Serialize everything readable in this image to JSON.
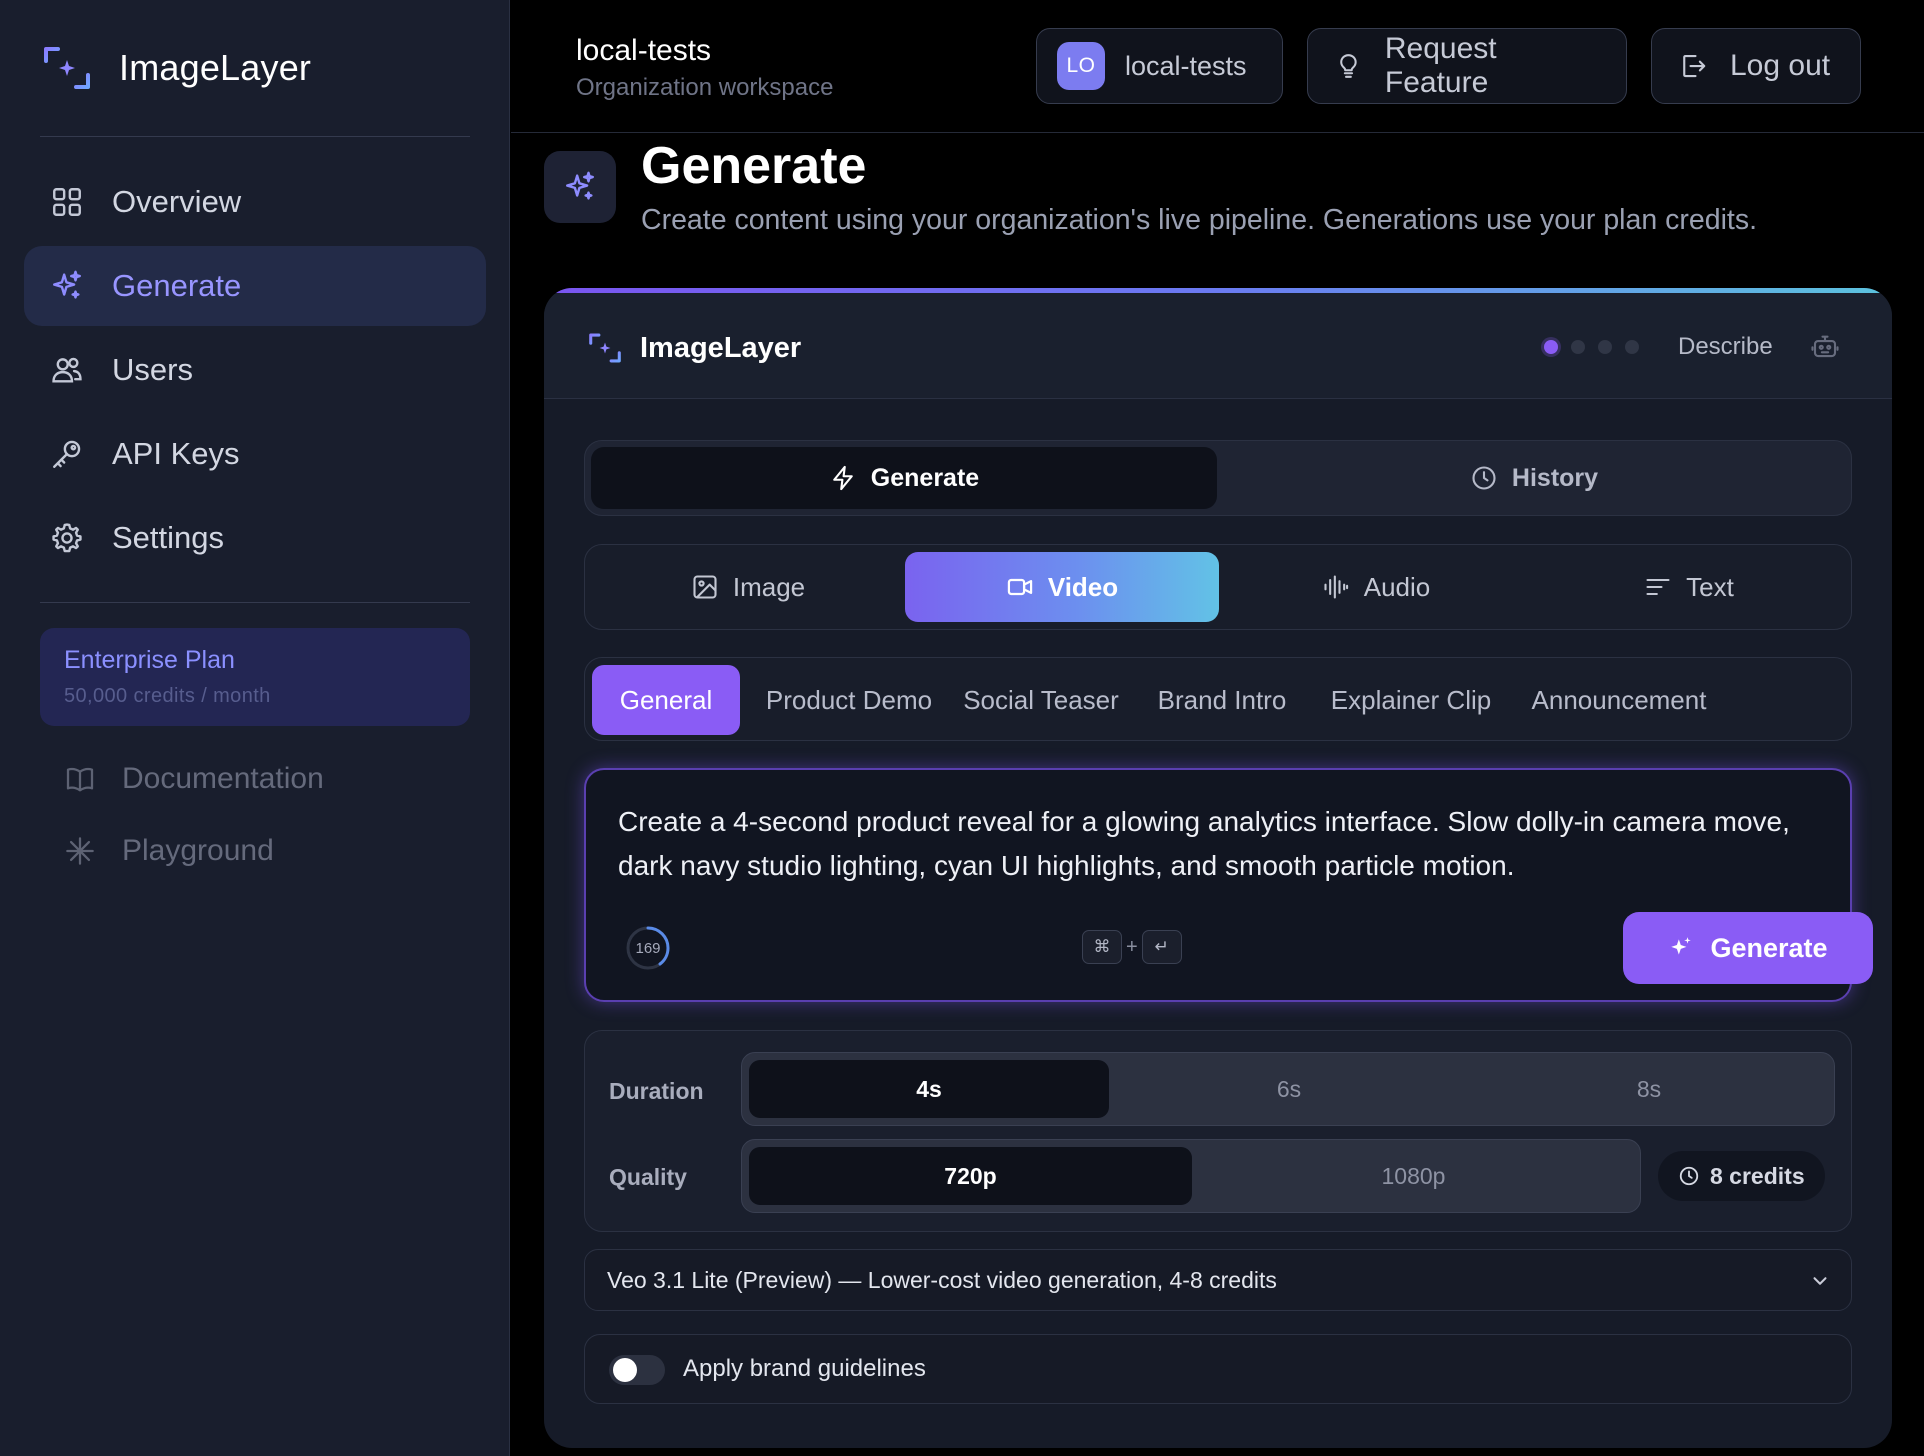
{
  "app": {
    "name": "ImageLayer",
    "accent": "#8a5cf5",
    "nav_active_color": "#9895ff"
  },
  "sidebar": {
    "items": [
      {
        "label": "Overview",
        "icon": "grid-icon",
        "active": false
      },
      {
        "label": "Generate",
        "icon": "sparkles-icon",
        "active": true
      },
      {
        "label": "Users",
        "icon": "users-icon",
        "active": false
      },
      {
        "label": "API Keys",
        "icon": "key-icon",
        "active": false
      },
      {
        "label": "Settings",
        "icon": "gear-icon",
        "active": false
      }
    ],
    "plan": {
      "name": "Enterprise Plan",
      "sub": "50,000 credits / month"
    },
    "links": [
      {
        "label": "Documentation",
        "icon": "book-icon"
      },
      {
        "label": "Playground",
        "icon": "asterisk-icon"
      }
    ]
  },
  "header": {
    "workspace_title": "local-tests",
    "workspace_sub": "Organization workspace",
    "org_badge": "LO",
    "org_name": "local-tests",
    "request_feature": "Request Feature",
    "logout": "Log out"
  },
  "page": {
    "title": "Generate",
    "subtitle": "Create content using your organization's live pipeline. Generations use your plan credits."
  },
  "widget": {
    "brand": "ImageLayer",
    "step_dots": {
      "total": 4,
      "active": 1
    },
    "describe_label": "Describe",
    "mode_tabs": [
      {
        "label": "Generate",
        "icon": "lightning-icon",
        "active": true
      },
      {
        "label": "History",
        "icon": "clock-icon",
        "active": false
      }
    ],
    "type_tabs": [
      {
        "label": "Image",
        "icon": "image-icon",
        "active": false
      },
      {
        "label": "Video",
        "icon": "video-icon",
        "active": true
      },
      {
        "label": "Audio",
        "icon": "audio-wave-icon",
        "active": false
      },
      {
        "label": "Text",
        "icon": "text-lines-icon",
        "active": false
      }
    ],
    "presets": [
      {
        "label": "General",
        "active": true
      },
      {
        "label": "Product Demo",
        "active": false
      },
      {
        "label": "Social Teaser",
        "active": false
      },
      {
        "label": "Brand Intro",
        "active": false
      },
      {
        "label": "Explainer Clip",
        "active": false
      },
      {
        "label": "Announcement",
        "active": false
      }
    ],
    "prompt": {
      "text": "Create a 4-second product reveal for a glowing analytics interface. Slow dolly-in camera move, dark navy studio lighting, cyan UI highlights, and smooth particle motion.",
      "char_count": "169",
      "shortcut_keys": [
        "⌘",
        "+",
        "↵"
      ],
      "generate_label": "Generate"
    },
    "settings": {
      "duration_label": "Duration",
      "duration_options": [
        {
          "label": "4s",
          "active": true
        },
        {
          "label": "6s",
          "active": false
        },
        {
          "label": "8s",
          "active": false
        }
      ],
      "quality_label": "Quality",
      "quality_options": [
        {
          "label": "720p",
          "active": true
        },
        {
          "label": "1080p",
          "active": false
        }
      ],
      "credits_label": "8 credits"
    },
    "model": {
      "selected": "Veo 3.1 Lite (Preview) — Lower-cost video generation, 4-8 credits"
    },
    "brand_guidelines": {
      "label": "Apply brand guidelines",
      "enabled": false
    }
  }
}
